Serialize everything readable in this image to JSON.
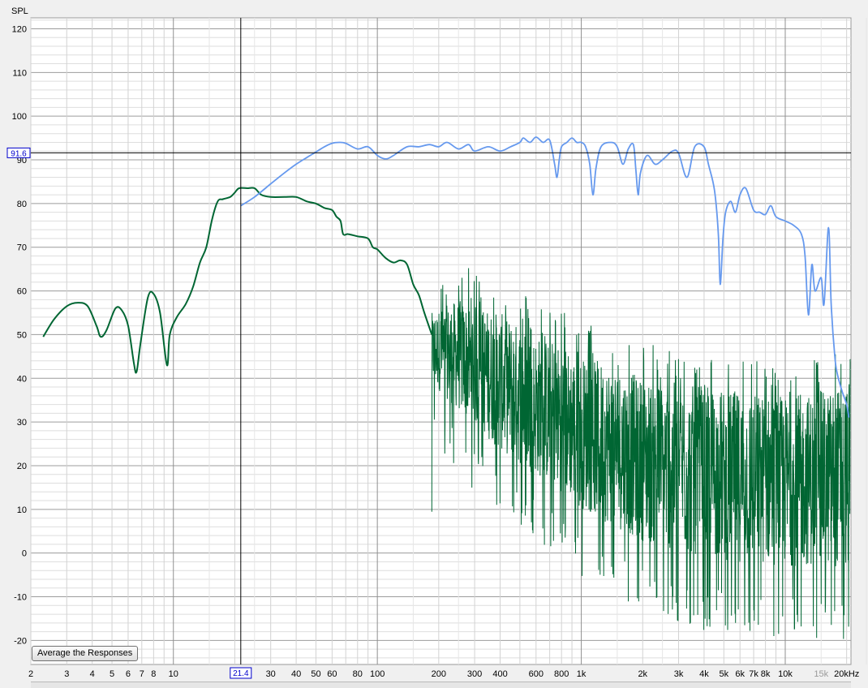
{
  "chart_data": {
    "type": "line",
    "ylabel": "SPL",
    "xlabel": "",
    "x_scale": "log",
    "xlim": [
      2,
      21000
    ],
    "ylim": [
      -25.5,
      122.5
    ],
    "grid": true,
    "y_ticks": [
      "120",
      "110",
      "100",
      "90",
      "80",
      "70",
      "60",
      "50",
      "40",
      "30",
      "20",
      "10",
      "0",
      "-10",
      "-20"
    ],
    "y_tick_values": [
      120,
      110,
      100,
      90,
      80,
      70,
      60,
      50,
      40,
      30,
      20,
      10,
      0,
      -10,
      -20
    ],
    "x_ticks": [
      {
        "f": 2,
        "label": "2"
      },
      {
        "f": 3,
        "label": "3"
      },
      {
        "f": 4,
        "label": "4"
      },
      {
        "f": 5,
        "label": "5"
      },
      {
        "f": 6,
        "label": "6"
      },
      {
        "f": 7,
        "label": "7"
      },
      {
        "f": 8,
        "label": "8"
      },
      {
        "f": 10,
        "label": "10"
      },
      {
        "f": 30,
        "label": "30"
      },
      {
        "f": 40,
        "label": "40"
      },
      {
        "f": 50,
        "label": "50"
      },
      {
        "f": 60,
        "label": "60"
      },
      {
        "f": 80,
        "label": "80"
      },
      {
        "f": 100,
        "label": "100"
      },
      {
        "f": 200,
        "label": "200"
      },
      {
        "f": 300,
        "label": "300"
      },
      {
        "f": 400,
        "label": "400"
      },
      {
        "f": 600,
        "label": "600"
      },
      {
        "f": 800,
        "label": "800"
      },
      {
        "f": 1000,
        "label": "1k"
      },
      {
        "f": 2000,
        "label": "2k"
      },
      {
        "f": 3000,
        "label": "3k"
      },
      {
        "f": 4000,
        "label": "4k"
      },
      {
        "f": 5000,
        "label": "5k"
      },
      {
        "f": 6000,
        "label": "6k"
      },
      {
        "f": 7000,
        "label": "7k"
      },
      {
        "f": 8000,
        "label": "8k"
      },
      {
        "f": 10000,
        "label": "10k"
      },
      {
        "f": 15000,
        "label": "15k",
        "minor": true
      },
      {
        "f": 20000,
        "label": "20kHz"
      }
    ],
    "cursor": {
      "x": 21.4,
      "y": 91.6,
      "x_label": "21.4",
      "y_label": "91.6"
    },
    "series": [
      {
        "color": "#6699ee",
        "points": [
          [
            21.4,
            79.5
          ],
          [
            25,
            81.5
          ],
          [
            30,
            84.5
          ],
          [
            35,
            87
          ],
          [
            40,
            89
          ],
          [
            45,
            90.5
          ],
          [
            50,
            91.8
          ],
          [
            55,
            93
          ],
          [
            60,
            93.8
          ],
          [
            65,
            94
          ],
          [
            70,
            93.8
          ],
          [
            80,
            92.5
          ],
          [
            90,
            93
          ],
          [
            100,
            91
          ],
          [
            110,
            90.2
          ],
          [
            120,
            91
          ],
          [
            140,
            93
          ],
          [
            160,
            93
          ],
          [
            180,
            93.5
          ],
          [
            200,
            93
          ],
          [
            220,
            94
          ],
          [
            250,
            92.5
          ],
          [
            280,
            93.5
          ],
          [
            300,
            92
          ],
          [
            350,
            93
          ],
          [
            400,
            92
          ],
          [
            450,
            93
          ],
          [
            500,
            94
          ],
          [
            520,
            95
          ],
          [
            560,
            94
          ],
          [
            600,
            95.2
          ],
          [
            650,
            94
          ],
          [
            700,
            94.5
          ],
          [
            740,
            89
          ],
          [
            760,
            86
          ],
          [
            780,
            90
          ],
          [
            800,
            93
          ],
          [
            850,
            94
          ],
          [
            900,
            95
          ],
          [
            950,
            94
          ],
          [
            1000,
            94
          ],
          [
            1050,
            93
          ],
          [
            1100,
            89
          ],
          [
            1140,
            82
          ],
          [
            1180,
            88
          ],
          [
            1250,
            93
          ],
          [
            1400,
            94
          ],
          [
            1500,
            93
          ],
          [
            1600,
            89
          ],
          [
            1700,
            92.5
          ],
          [
            1800,
            93.5
          ],
          [
            1850,
            88
          ],
          [
            1900,
            82
          ],
          [
            1950,
            87
          ],
          [
            2100,
            91
          ],
          [
            2300,
            89
          ],
          [
            2500,
            90
          ],
          [
            2800,
            92
          ],
          [
            3000,
            91.5
          ],
          [
            3300,
            86
          ],
          [
            3600,
            93
          ],
          [
            4000,
            93
          ],
          [
            4200,
            89
          ],
          [
            4500,
            83
          ],
          [
            4700,
            73
          ],
          [
            4800,
            61.5
          ],
          [
            4950,
            72
          ],
          [
            5100,
            78
          ],
          [
            5400,
            80.5
          ],
          [
            5700,
            78
          ],
          [
            6000,
            82
          ],
          [
            6400,
            83.5
          ],
          [
            7000,
            78.5
          ],
          [
            7500,
            78
          ],
          [
            8000,
            77.5
          ],
          [
            8500,
            79.5
          ],
          [
            9000,
            77
          ],
          [
            10000,
            76
          ],
          [
            11000,
            75
          ],
          [
            12000,
            73
          ],
          [
            12500,
            68
          ],
          [
            13000,
            54.5
          ],
          [
            13500,
            66
          ],
          [
            14000,
            60
          ],
          [
            15000,
            63
          ],
          [
            15500,
            57
          ],
          [
            16300,
            74.5
          ],
          [
            16800,
            57
          ],
          [
            17500,
            45
          ],
          [
            18000,
            41
          ],
          [
            19000,
            37
          ],
          [
            20000,
            34
          ],
          [
            20500,
            31
          ]
        ]
      },
      {
        "color": "#006633",
        "points": [
          [
            2.3,
            49.5
          ],
          [
            2.6,
            53.5
          ],
          [
            3,
            56.5
          ],
          [
            3.4,
            57.3
          ],
          [
            3.8,
            56.5
          ],
          [
            4.2,
            52
          ],
          [
            4.4,
            49.5
          ],
          [
            4.7,
            51
          ],
          [
            5.2,
            56
          ],
          [
            5.6,
            55.5
          ],
          [
            6,
            52
          ],
          [
            6.4,
            43.5
          ],
          [
            6.6,
            41.5
          ],
          [
            6.9,
            48
          ],
          [
            7.5,
            58.5
          ],
          [
            8,
            59.3
          ],
          [
            8.6,
            55
          ],
          [
            9.3,
            43
          ],
          [
            9.6,
            50
          ],
          [
            10.4,
            54
          ],
          [
            11.5,
            57
          ],
          [
            12.5,
            61
          ],
          [
            13.5,
            66.5
          ],
          [
            14.5,
            70
          ],
          [
            15.5,
            76.5
          ],
          [
            16.5,
            80.5
          ],
          [
            17.5,
            81
          ],
          [
            19,
            81.5
          ],
          [
            20,
            82.5
          ],
          [
            21,
            83.5
          ],
          [
            23,
            83.5
          ],
          [
            25,
            83.5
          ],
          [
            27,
            82
          ],
          [
            30,
            81.5
          ],
          [
            35,
            81.5
          ],
          [
            40,
            81.5
          ],
          [
            45,
            80.5
          ],
          [
            50,
            80
          ],
          [
            55,
            79
          ],
          [
            60,
            78.5
          ],
          [
            63,
            77
          ],
          [
            66,
            76
          ],
          [
            68,
            73
          ],
          [
            72,
            73
          ],
          [
            80,
            72.5
          ],
          [
            90,
            72
          ],
          [
            95,
            70
          ],
          [
            100,
            69.5
          ],
          [
            110,
            67.5
          ],
          [
            120,
            66.5
          ],
          [
            130,
            67
          ],
          [
            140,
            66
          ],
          [
            150,
            61.5
          ],
          [
            160,
            59
          ],
          [
            170,
            55
          ],
          [
            185,
            50
          ]
        ]
      }
    ],
    "noise": {
      "color": "#006633",
      "f_start": 185,
      "f_end": 20800,
      "envelope": [
        [
          185,
          55,
          36
        ],
        [
          250,
          58,
          28
        ],
        [
          400,
          55,
          18
        ],
        [
          600,
          50,
          12
        ],
        [
          800,
          48,
          8
        ],
        [
          1000,
          45,
          4
        ],
        [
          1500,
          43,
          -1
        ],
        [
          2000,
          40,
          -4
        ],
        [
          3000,
          39,
          -7
        ],
        [
          4000,
          38,
          -8
        ],
        [
          6000,
          37,
          -9
        ],
        [
          10000,
          36,
          -10
        ],
        [
          15000,
          37,
          -10
        ],
        [
          20800,
          39,
          -11
        ]
      ]
    }
  },
  "buttons": {
    "average": "Average the Responses"
  }
}
